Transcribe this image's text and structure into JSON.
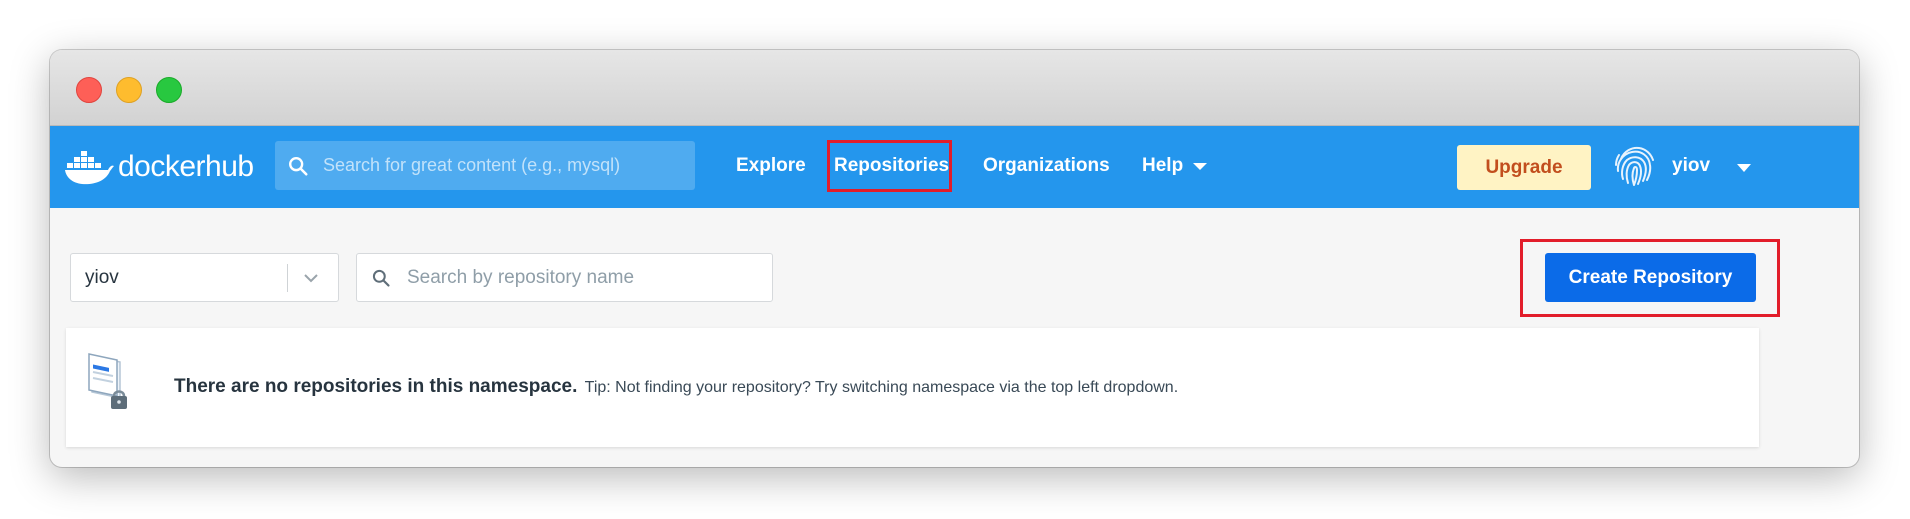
{
  "colors": {
    "nav_bg": "#2496ed",
    "primary_button": "#0b6be8",
    "upgrade_bg": "#fff3c4",
    "upgrade_text": "#c24e1e",
    "highlight": "#e21d2a"
  },
  "header": {
    "logo_text": "dockerhub",
    "search_placeholder": "Search for great content (e.g., mysql)",
    "nav": {
      "explore": "Explore",
      "repositories": "Repositories",
      "organizations": "Organizations",
      "help": "Help"
    },
    "upgrade_label": "Upgrade",
    "username": "yiov"
  },
  "toolbar": {
    "namespace": "yiov",
    "repo_search_placeholder": "Search by repository name",
    "create_label": "Create Repository"
  },
  "empty_state": {
    "title": "There are no repositories in this namespace.",
    "tip": "Tip: Not finding your repository? Try switching namespace via the top left dropdown."
  },
  "icons": [
    "docker-whale-icon",
    "search-icon",
    "chevron-down-icon",
    "fingerprint-avatar-icon",
    "repo-lock-illustration"
  ]
}
